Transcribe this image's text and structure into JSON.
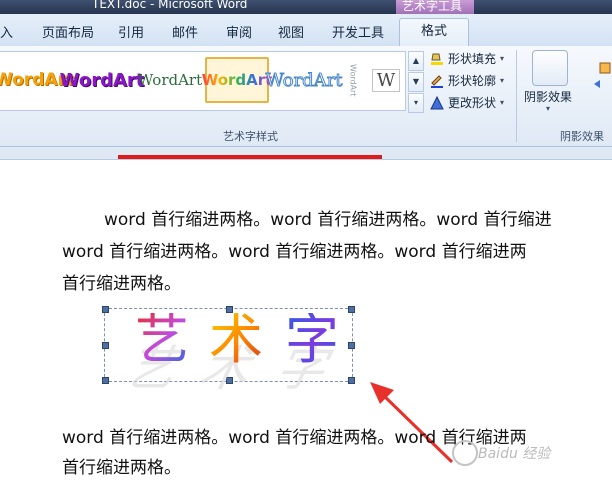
{
  "window": {
    "title": "TEXT.doc - Microsoft Word",
    "contextual_tab_group": "艺术字工具"
  },
  "ribbon_tabs": [
    {
      "label": "入"
    },
    {
      "label": "页面布局"
    },
    {
      "label": "引用"
    },
    {
      "label": "邮件"
    },
    {
      "label": "审阅"
    },
    {
      "label": "视图"
    },
    {
      "label": "开发工具"
    },
    {
      "label": "格式"
    }
  ],
  "styles_group": {
    "label": "艺术字样式",
    "gallery": [
      {
        "text": "WordArt",
        "color": "#f2a20c"
      },
      {
        "text": "WordArt",
        "color": "#8a17c4"
      },
      {
        "text": "WordArt",
        "color": "#2c6b3a"
      },
      {
        "text": "WordArt",
        "color": "#d93b9b"
      },
      {
        "text": "WordArt",
        "color": "#4a88c8"
      },
      {
        "text": "WordArt",
        "color": "#9aa0aa"
      },
      {
        "text": "W",
        "color": "#4a4a4a"
      }
    ],
    "shape_fill": "形状填充",
    "shape_outline": "形状轮廓",
    "change_shape": "更改形状"
  },
  "shadow_group": {
    "button": "阴影效果",
    "label": "阴影效果"
  },
  "document": {
    "paragraph1": [
      "word 首行缩进两格。word 首行缩进两格。word 首行缩进",
      "word 首行缩进两格。word 首行缩进两格。word 首行缩进两",
      "首行缩进两格。"
    ],
    "wordart": {
      "characters": [
        "艺",
        "术",
        "字"
      ]
    },
    "paragraph2": [
      "word 首行缩进两格。word 首行缩进两格。word 首行缩进两",
      "首行缩进两格。"
    ]
  },
  "watermark": "Baidu 经验"
}
